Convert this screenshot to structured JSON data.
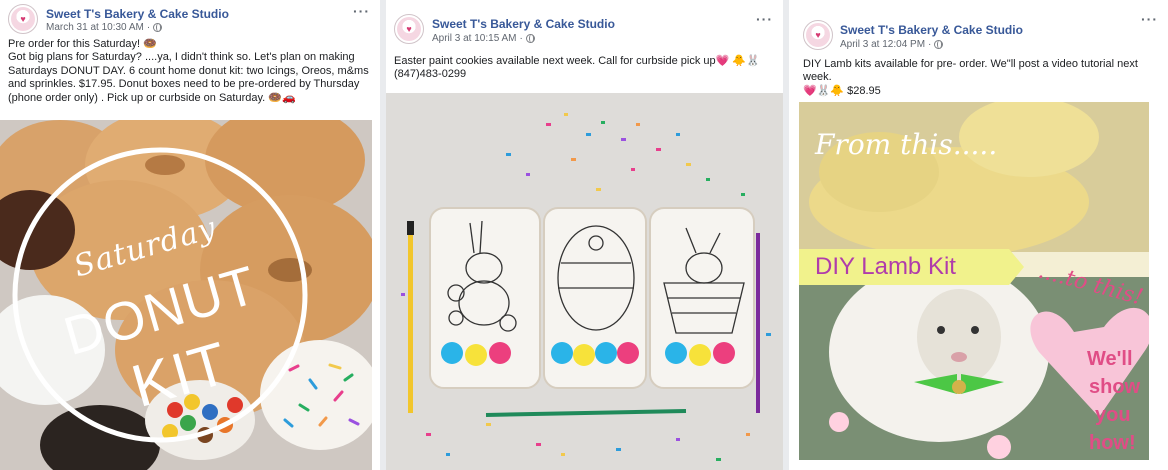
{
  "posts": [
    {
      "page_name": "Sweet T's Bakery & Cake Studio",
      "timestamp": "March 31 at 10:30 AM",
      "text": "Pre order for this Saturday! 🍩\nGot big plans for Saturday? ....ya, I didn't think so. Let's plan on making Saturdays DONUT DAY. 6 count home donut kit: two Icings, Oreos, m&ms and sprinkles. $17.95. Donut boxes need to be pre-ordered by Thursday (phone order only) . Pick up or curbside on Saturday. 🍩🚗",
      "image": {
        "script_text": "Saturday",
        "line1": "DONUT",
        "line2": "KIT"
      }
    },
    {
      "page_name": "Sweet T's Bakery & Cake Studio",
      "timestamp": "April 3 at 10:15 AM",
      "text": "Easter paint cookies available next week. Call for curbside pick up💗 🐥🐰\n(847)483-0299"
    },
    {
      "page_name": "Sweet T's Bakery & Cake Studio",
      "timestamp": "April 3 at 12:04 PM",
      "text": "DIY Lamb kits available for pre- order. We\"ll post a video tutorial next week.\n💗🐰🐥 $28.95",
      "image": {
        "top_caption": "From this.....",
        "banner": "DIY Lamb Kit",
        "heart_text": "....to this!",
        "bottom_text_1": "We'll",
        "bottom_text_2": "show",
        "bottom_text_3": "you",
        "bottom_text_4": "how!"
      }
    }
  ],
  "icons": {
    "more": "more-options-icon",
    "audience": "globe-icon"
  },
  "colors": {
    "page_name": "#385898",
    "meta": "#616770",
    "banner_text": "#b03cab",
    "banner_bg": "#f1f28c",
    "heart": "#f9c7d8",
    "pink_text": "#e04d86"
  }
}
